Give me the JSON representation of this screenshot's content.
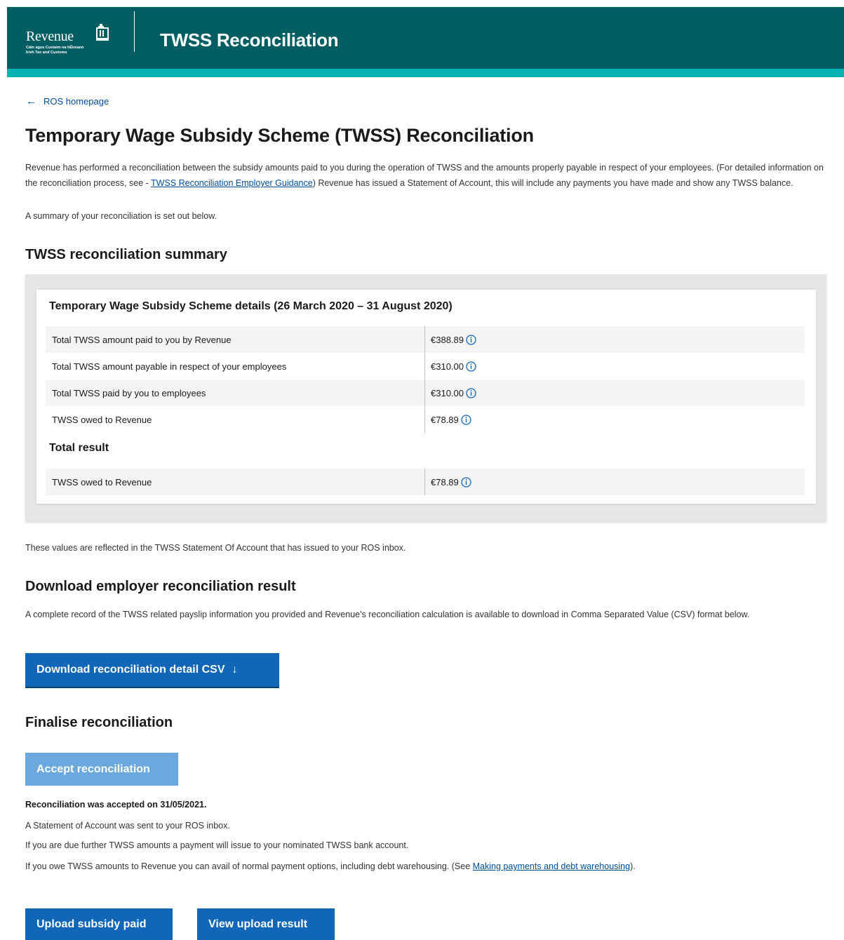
{
  "header": {
    "logo_word": "Revenue",
    "logo_sub_line1": "Cáin agus Custaim na hÉireann",
    "logo_sub_line2": "Irish Tax and Customs",
    "title": "TWSS Reconciliation",
    "colors": {
      "header_bg": "#005e62",
      "accent_strip": "#00b3b3"
    }
  },
  "nav": {
    "back_label": "ROS homepage",
    "back_icon": "arrow-left-icon"
  },
  "page": {
    "title": "Temporary Wage Subsidy Scheme (TWSS) Reconciliation",
    "intro_before_link": "Revenue has performed a reconciliation between the subsidy amounts paid to you during the operation of TWSS and the amounts properly payable in respect of your employees. (For detailed information on the reconciliation process, see - ",
    "intro_link": "TWSS Reconciliation Employer Guidance",
    "intro_after_link": ") Revenue has issued a Statement of Account, this will include any payments you have made and show any TWSS balance.",
    "summary_line": "A summary of your reconciliation is set out below."
  },
  "summary": {
    "heading": "TWSS reconciliation summary",
    "details_title": "Temporary Wage Subsidy Scheme details (26 March 2020 – 31 August 2020)",
    "rows": [
      {
        "label": "Total TWSS amount paid to you by Revenue",
        "value": "€388.89"
      },
      {
        "label": "Total TWSS amount payable in respect of your employees",
        "value": "€310.00"
      },
      {
        "label": "Total TWSS paid by you to employees",
        "value": "€310.00"
      },
      {
        "label": "TWSS owed to Revenue",
        "value": "€78.89"
      }
    ],
    "total_title": "Total result",
    "total_row": {
      "label": "TWSS owed to Revenue",
      "value": "€78.89"
    },
    "info_icon": "info-circle-icon"
  },
  "reflect_text": "These values are reflected in the TWSS Statement Of Account that has issued to your ROS inbox.",
  "download": {
    "heading": "Download employer reconciliation result",
    "text": "A complete record of the TWSS related payslip information you provided and Revenue's reconciliation calculation is available to download in Comma Separated Value (CSV) format below.",
    "button_label": "Download reconciliation detail CSV",
    "button_icon": "arrow-down-icon"
  },
  "finalise": {
    "heading": "Finalise reconciliation",
    "accept_label": "Accept reconciliation",
    "accepted_note": "Reconciliation was accepted on 31/05/2021.",
    "note1": "A Statement of Account was sent to your ROS inbox.",
    "note2": "If you are due further TWSS amounts a payment will issue to your nominated TWSS bank account.",
    "note3_before_link": "If you owe TWSS amounts to Revenue you can avail of normal payment options, including debt warehousing. (See ",
    "note3_link": "Making payments and debt warehousing",
    "note3_after_link": ")."
  },
  "actions": {
    "upload_label": "Upload subsidy paid",
    "view_label": "View upload result",
    "button_color": "#1166b7",
    "disabled_button_color": "#6aa8de"
  }
}
